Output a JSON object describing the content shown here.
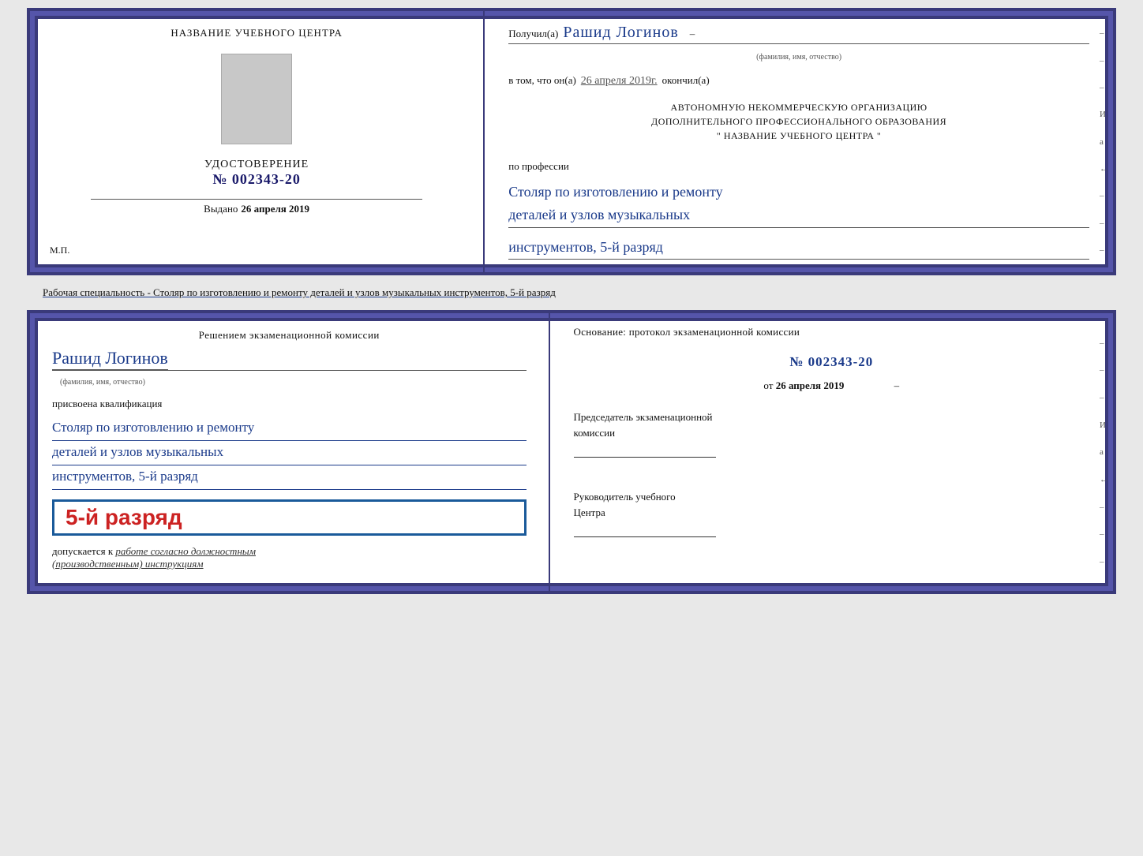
{
  "top_cert": {
    "left": {
      "title": "НАЗВАНИЕ УЧЕБНОГО ЦЕНТРА",
      "udostoverenie_label": "УДОСТОВЕРЕНИЕ",
      "number": "№ 002343-20",
      "vydano_label": "Выдано",
      "vydano_date": "26 апреля 2019",
      "mp_label": "М.П."
    },
    "right": {
      "poluchil_label": "Получил(а)",
      "name_handwritten": "Рашид Логинов",
      "fio_subtitle": "(фамилия, имя, отчество)",
      "dash": "–",
      "vtom_label": "в том, что он(а)",
      "vtom_date": "26 апреля 2019г.",
      "okonchil_label": "окончил(а)",
      "org_line1": "АВТОНОМНУЮ НЕКОММЕРЧЕСКУЮ ОРГАНИЗАЦИЮ",
      "org_line2": "ДОПОЛНИТЕЛЬНОГО ПРОФЕССИОНАЛЬНОГО ОБРАЗОВАНИЯ",
      "org_line3": "\" НАЗВАНИЕ УЧЕБНОГО ЦЕНТРА \"",
      "po_professii_label": "по профессии",
      "profession_line1": "Столяр по изготовлению и ремонту",
      "profession_line2": "деталей и узлов музыкальных",
      "profession_line3": "инструментов, 5-й разряд",
      "side_dashes": [
        "–",
        "–",
        "–",
        "И",
        "а",
        "←",
        "–",
        "–",
        "–"
      ]
    }
  },
  "specialty_text": "Рабочая специальность - Столяр по изготовлению и ремонту деталей и узлов музыкальных инструментов, 5-й разряд",
  "bottom_cert": {
    "left": {
      "decision_text": "Решением экзаменационной комиссии",
      "name_handwritten": "Рашид Логинов",
      "fio_subtitle": "(фамилия, имя, отчество)",
      "prisvoena_label": "присвоена квалификация",
      "qual_line1": "Столяр по изготовлению и ремонту",
      "qual_line2": "деталей и узлов музыкальных",
      "qual_line3": "инструментов, 5-й разряд",
      "rank_text": "5-й разряд",
      "dopuskaetsya_label": "допускается к",
      "dopuskaetsya_value": "работе согласно должностным",
      "instruktsii_value": "(производственным) инструкциям"
    },
    "right": {
      "osnovanie_label": "Основание: протокол экзаменационной комиссии",
      "proto_number": "№ 002343-20",
      "ot_label": "от",
      "ot_date": "26 апреля 2019",
      "predsedatel_label": "Председатель экзаменационной",
      "predsedatel_label2": "комиссии",
      "rukovoditel_label": "Руководитель учебного",
      "rukovoditel_label2": "Центра",
      "side_dashes": [
        "–",
        "–",
        "–",
        "И",
        "а",
        "←",
        "–",
        "–",
        "–"
      ]
    }
  }
}
